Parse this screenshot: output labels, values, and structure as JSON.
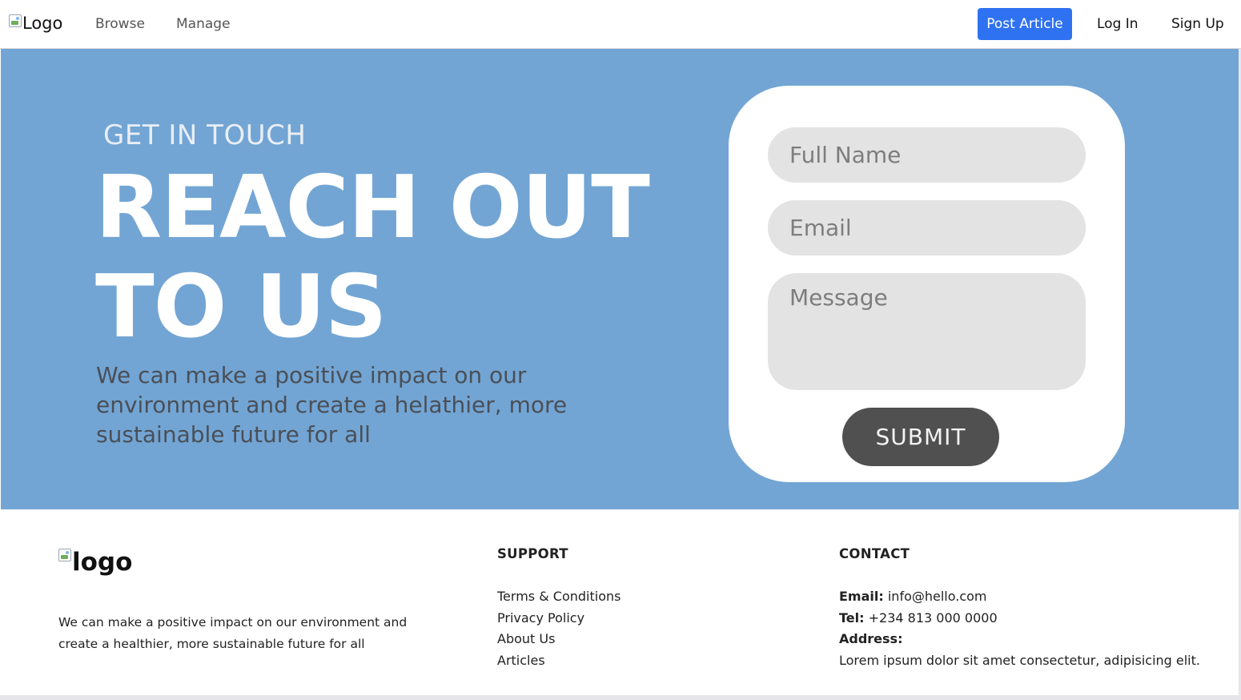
{
  "nav": {
    "logo_alt": "Logo",
    "links": [
      {
        "label": "Browse"
      },
      {
        "label": "Manage"
      }
    ],
    "post_label": "Post Article",
    "login_label": "Log In",
    "signup_label": "Sign Up"
  },
  "hero": {
    "eyebrow": "GET IN TOUCH",
    "headline_line1": "REACH OUT",
    "headline_line2": "TO US",
    "description": "We can make a positive impact on our environment and create a helathier, more sustainable future for all"
  },
  "form": {
    "name_placeholder": "Full Name",
    "email_placeholder": "Email",
    "message_placeholder": "Message",
    "submit_label": "SUBMIT"
  },
  "footer": {
    "logo_alt": "logo",
    "description": "We can make a positive impact on our environment and create a healthier, more sustainable future for all",
    "support": {
      "title": "SUPPORT",
      "links": [
        "Terms & Conditions",
        "Privacy Policy",
        "About Us",
        "Articles"
      ]
    },
    "contact": {
      "title": "CONTACT",
      "email_label": "Email:",
      "email_value": "info@hello.com",
      "tel_label": "Tel:",
      "tel_value": "+234 813 000 0000",
      "address_label": "Address:",
      "address_value": "Lorem ipsum dolor sit amet consectetur, adipisicing elit."
    }
  },
  "colors": {
    "hero_bg": "#72a5d4",
    "primary_button": "#2f72f1",
    "submit_button": "#505050",
    "field_bg": "#e3e3e3"
  }
}
